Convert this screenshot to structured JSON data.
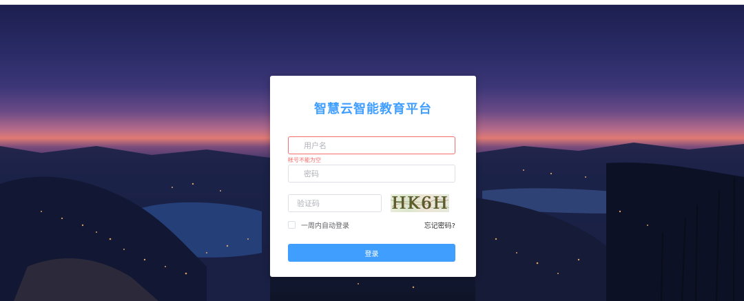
{
  "login": {
    "title": "智慧云智能教育平台",
    "username_placeholder": "用户名",
    "username_error": "帐号不能为空",
    "password_placeholder": "密码",
    "captcha_placeholder": "验证码",
    "captcha_code": "HK6H",
    "remember_label": "一周内自动登录",
    "forgot_label": "忘记密码?",
    "submit_label": "登录"
  },
  "colors": {
    "accent": "#409eff",
    "error": "#f56c6c"
  }
}
